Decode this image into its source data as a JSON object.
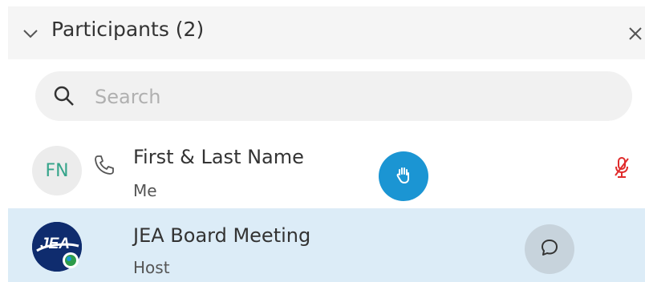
{
  "panel": {
    "title": "Participants (2)",
    "collapse_icon": "chevron-down-icon",
    "close_icon": "close-icon"
  },
  "search": {
    "placeholder": "Search",
    "value": "",
    "icon": "search-icon"
  },
  "participants": [
    {
      "initials": "FN",
      "name": "First & Last Name",
      "role": "Me",
      "audio_icon": "phone-icon",
      "hand_icon": "raised-hand-icon",
      "mic_icon": "mic-muted-icon",
      "hand_color": "#1b95d3",
      "mic_color": "#e02b2b",
      "initials_color": "#35a48a"
    },
    {
      "avatar_logo_text": "JEA",
      "name": "JEA Board Meeting",
      "role": "Host",
      "chat_icon": "chat-icon",
      "row_highlight": "#dcecf7"
    }
  ]
}
